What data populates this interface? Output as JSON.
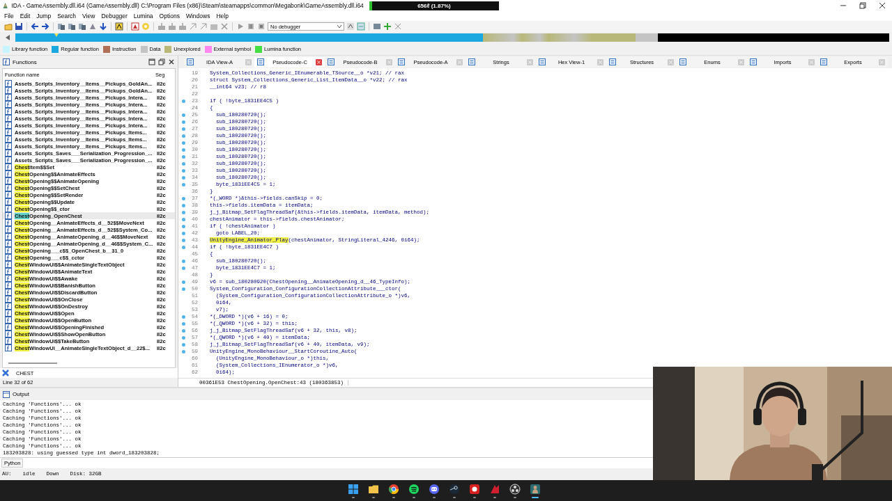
{
  "window": {
    "title": "IDA - GameAssembly.dll.i64 (GameAssembly.dll) C:\\Program Files (x86)\\Steam\\steamapps\\common\\Megabonk\\GameAssembly.dll.i64"
  },
  "meter": {
    "text": "656ℓ (1.87%)",
    "level": 0.02
  },
  "menu": [
    "File",
    "Edit",
    "Jump",
    "Search",
    "View",
    "Debugger",
    "Lumina",
    "Options",
    "Windows",
    "Help"
  ],
  "debugger_select": {
    "value": "No debugger"
  },
  "legend": [
    {
      "label": "Library function",
      "color": "#c8f4ff"
    },
    {
      "label": "Regular function",
      "color": "#1ba8e0"
    },
    {
      "label": "Instruction",
      "color": "#b07058"
    },
    {
      "label": "Data",
      "color": "#c4c4c4"
    },
    {
      "label": "Unexplored",
      "color": "#b8b878"
    },
    {
      "label": "External symbol",
      "color": "#ff88f0"
    },
    {
      "label": "Lumina function",
      "color": "#44dd44"
    }
  ],
  "functions_panel": {
    "title": "Functions",
    "columns": [
      "Function name",
      "Seg"
    ],
    "rows": [
      {
        "name": "Assets_Scripts_Inventory__Items__Pickups_GoldAn...",
        "seg": "il2c",
        "selected": false
      },
      {
        "name": "Assets_Scripts_Inventory__Items__Pickups_GoldAn...",
        "seg": "il2c",
        "selected": false
      },
      {
        "name": "Assets_Scripts_Inventory__Items__Pickups_Intera...",
        "seg": "il2c",
        "selected": false
      },
      {
        "name": "Assets_Scripts_Inventory__Items__Pickups_Intera...",
        "seg": "il2c",
        "selected": false
      },
      {
        "name": "Assets_Scripts_Inventory__Items__Pickups_Intera...",
        "seg": "il2c",
        "selected": false
      },
      {
        "name": "Assets_Scripts_Inventory__Items__Pickups_Intera...",
        "seg": "il2c",
        "selected": false
      },
      {
        "name": "Assets_Scripts_Inventory__Items__Pickups_Intera...",
        "seg": "il2c",
        "selected": false
      },
      {
        "name": "Assets_Scripts_Inventory__Items__Pickups_Items...",
        "seg": "il2c",
        "selected": false
      },
      {
        "name": "Assets_Scripts_Inventory__Items__Pickups_Items...",
        "seg": "il2c",
        "selected": false
      },
      {
        "name": "Assets_Scripts_Inventory__Items__Pickups_Items...",
        "seg": "il2c",
        "selected": false
      },
      {
        "name": "Assets_Scripts_Saves___Serialization_Progression_...",
        "seg": "il2c",
        "selected": false
      },
      {
        "name": "Assets_Scripts_Saves___Serialization_Progression_...",
        "seg": "il2c",
        "selected": false
      },
      {
        "match": "Chest",
        "name": "Item$$Set",
        "seg": "il2c",
        "selected": false
      },
      {
        "match": "Chest",
        "name": "Opening$$AnimateEffects",
        "seg": "il2c",
        "selected": false
      },
      {
        "match": "Chest",
        "name": "Opening$$AnimateOpening",
        "seg": "il2c",
        "selected": false
      },
      {
        "match": "Chest",
        "name": "Opening$$SetChest",
        "seg": "il2c",
        "selected": false
      },
      {
        "match": "Chest",
        "name": "Opening$$SetRender",
        "seg": "il2c",
        "selected": false
      },
      {
        "match": "Chest",
        "name": "Opening$$Update",
        "seg": "il2c",
        "selected": false
      },
      {
        "match": "Chest",
        "name": "Opening$$_ctor",
        "seg": "il2c",
        "selected": false
      },
      {
        "match": "Chest",
        "name": "Opening_OpenChest",
        "seg": "il2c",
        "selected": true
      },
      {
        "match": "Chest",
        "name": "Opening__AnimateEffects_d__52$$MoveNext",
        "seg": "il2c",
        "selected": false
      },
      {
        "match": "Chest",
        "name": "Opening__AnimateEffects_d__52$$System_Co...",
        "seg": "il2c",
        "selected": false
      },
      {
        "match": "Chest",
        "name": "Opening__AnimateOpening_d__46$$MoveNext",
        "seg": "il2c",
        "selected": false
      },
      {
        "match": "Chest",
        "name": "Opening__AnimateOpening_d__46$$System_C...",
        "seg": "il2c",
        "selected": false
      },
      {
        "match": "Chest",
        "name": "Opening___c$$_OpenChest_b__31_0",
        "seg": "il2c",
        "selected": false
      },
      {
        "match": "Chest",
        "name": "Opening___c$$_cctor",
        "seg": "il2c",
        "selected": false
      },
      {
        "match": "Chest",
        "name": "WindowUi$$AnimateSingleTextObject",
        "seg": "il2c",
        "selected": false
      },
      {
        "match": "Chest",
        "name": "WindowUi$$AnimateText",
        "seg": "il2c",
        "selected": false
      },
      {
        "match": "Chest",
        "name": "WindowUi$$Awake",
        "seg": "il2c",
        "selected": false
      },
      {
        "match": "Chest",
        "name": "WindowUi$$BanishButton",
        "seg": "il2c",
        "selected": false
      },
      {
        "match": "Chest",
        "name": "WindowUi$$DiscardButton",
        "seg": "il2c",
        "selected": false
      },
      {
        "match": "Chest",
        "name": "WindowUi$$OnClose",
        "seg": "il2c",
        "selected": false
      },
      {
        "match": "Chest",
        "name": "WindowUi$$OnDestroy",
        "seg": "il2c",
        "selected": false
      },
      {
        "match": "Chest",
        "name": "WindowUi$$Open",
        "seg": "il2c",
        "selected": false
      },
      {
        "match": "Chest",
        "name": "WindowUi$$OpenButton",
        "seg": "il2c",
        "selected": false
      },
      {
        "match": "Chest",
        "name": "WindowUi$$OpeningFinished",
        "seg": "il2c",
        "selected": false
      },
      {
        "match": "Chest",
        "name": "WindowUi$$ShowOpenButton",
        "seg": "il2c",
        "selected": false
      },
      {
        "match": "Chest",
        "name": "WindowUi$$TakeButton",
        "seg": "il2c",
        "selected": false
      },
      {
        "match": "Chest",
        "name": "WindowUi__AnimateSingleTextObject_d__22$...",
        "seg": "il2c",
        "selected": false
      }
    ],
    "filter": "CHEST",
    "position": "Line 32 of 62"
  },
  "tabs": [
    {
      "label": "IDA View-A",
      "selected": false
    },
    {
      "label": "Pseudocode-C",
      "selected": true
    },
    {
      "label": "Pseudocode-B",
      "selected": false
    },
    {
      "label": "Pseudocode-A",
      "selected": false
    },
    {
      "label": "Strings",
      "selected": false
    },
    {
      "label": "Hex View-1",
      "selected": false
    },
    {
      "label": "Structures",
      "selected": false
    },
    {
      "label": "Enums",
      "selected": false
    },
    {
      "label": "Imports",
      "selected": false
    },
    {
      "label": "Exports",
      "selected": false
    }
  ],
  "code": {
    "lines": [
      {
        "num": "19",
        "dot": false,
        "indented": false,
        "text": "System_Collections_Generic_IEnumerable_TSource__o *v21; // rax"
      },
      {
        "num": "20",
        "dot": false,
        "indented": false,
        "text": "struct System_Collections_Generic_List_ItemData__o *v22; // rax"
      },
      {
        "num": "21",
        "dot": false,
        "indented": false,
        "text": "__int64 v23; // r8"
      },
      {
        "num": "22",
        "dot": false
      },
      {
        "num": "23",
        "dot": true,
        "indented": false,
        "text": "if ( !byte_1831EE4C5 )"
      },
      {
        "num": "24",
        "dot": false,
        "indented": false,
        "text": "{"
      },
      {
        "num": "25",
        "dot": true,
        "indented": true,
        "text": "sub_180280720();"
      },
      {
        "num": "26",
        "dot": true,
        "indented": true,
        "text": "sub_180280720();"
      },
      {
        "num": "27",
        "dot": true,
        "indented": true,
        "text": "sub_180280720();"
      },
      {
        "num": "28",
        "dot": true,
        "indented": true,
        "text": "sub_180280720();"
      },
      {
        "num": "29",
        "dot": true,
        "indented": true,
        "text": "sub_180280720();"
      },
      {
        "num": "30",
        "dot": true,
        "indented": true,
        "text": "sub_180280720();"
      },
      {
        "num": "31",
        "dot": true,
        "indented": true,
        "text": "sub_180280720();"
      },
      {
        "num": "32",
        "dot": true,
        "indented": true,
        "text": "sub_180280720();"
      },
      {
        "num": "33",
        "dot": true,
        "indented": true,
        "text": "sub_180280720();"
      },
      {
        "num": "34",
        "dot": true,
        "indented": true,
        "text": "sub_180280720();"
      },
      {
        "num": "35",
        "dot": true,
        "indented": true,
        "text": "byte_1831EE4C5 = 1;"
      },
      {
        "num": "36",
        "dot": false,
        "indented": false,
        "text": "}"
      },
      {
        "num": "37",
        "dot": true,
        "indented": false,
        "text": "*(_WORD *)&this->fields.canSkip = 0;"
      },
      {
        "num": "38",
        "dot": true,
        "indented": false,
        "text": "this->fields.itemData = itemData;"
      },
      {
        "num": "39",
        "dot": true,
        "indented": false,
        "text": "j_j_Bitmap_SetFlagThreadSaf(&this->fields.itemData, itemData, method);"
      },
      {
        "num": "40",
        "dot": true,
        "indented": false,
        "text": "chestAnimator = this->fields.chestAnimator;"
      },
      {
        "num": "41",
        "dot": true,
        "indented": false,
        "text": "if ( !chestAnimator )"
      },
      {
        "num": "42",
        "dot": true,
        "indented": true,
        "text": "goto LABEL_20;"
      },
      {
        "num": "43",
        "dot": true,
        "indented": false,
        "highlighted": "UnityEngine_Animator_Play",
        "text": "(chestAnimator, StringLiteral_4246, 0i64);"
      },
      {
        "num": "44",
        "dot": true,
        "indented": false,
        "text": "if ( !byte_1831EE4C7 )"
      },
      {
        "num": "45",
        "dot": false,
        "indented": false,
        "text": "{"
      },
      {
        "num": "46",
        "dot": true,
        "indented": true,
        "text": "sub_180280720();"
      },
      {
        "num": "47",
        "dot": true,
        "indented": true,
        "text": "byte_1831EE4C7 = 1;"
      },
      {
        "num": "48",
        "dot": false,
        "indented": false,
        "text": "}"
      },
      {
        "num": "49",
        "dot": true,
        "indented": false,
        "text": "v6 = sub_180280920(ChestOpening__AnimateOpening_d__46_TypeInfo);"
      },
      {
        "num": "50",
        "dot": true,
        "indented": false,
        "text": "System_Configuration_ConfigurationCollectionAttribute___ctor("
      },
      {
        "num": "51",
        "dot": false,
        "indented": true,
        "text": "(System_Configuration_ConfigurationCollectionAttribute_o *)v6,"
      },
      {
        "num": "52",
        "dot": false,
        "indented": true,
        "text": "0i64,"
      },
      {
        "num": "53",
        "dot": false,
        "indented": true,
        "text": "v7);"
      },
      {
        "num": "54",
        "dot": true,
        "indented": false,
        "text": "*(_DWORD *)(v6 + 16) = 0;"
      },
      {
        "num": "55",
        "dot": true,
        "indented": false,
        "text": "*(_QWORD *)(v6 + 32) = this;"
      },
      {
        "num": "56",
        "dot": true,
        "indented": false,
        "text": "j_j_Bitmap_SetFlagThreadSaf(v6 + 32, this, v8);"
      },
      {
        "num": "57",
        "dot": true,
        "indented": false,
        "text": "*(_QWORD *)(v6 + 40) = itemData;"
      },
      {
        "num": "58",
        "dot": true,
        "indented": false,
        "text": "j_j_Bitmap_SetFlagThreadSaf(v6 + 40, itemData, v9);"
      },
      {
        "num": "59",
        "dot": true,
        "indented": false,
        "text": "UnityEngine_MonoBehaviour__StartCoroutine_Auto("
      },
      {
        "num": "60",
        "dot": false,
        "indented": true,
        "text": "(UnityEngine_MonoBehaviour_o *)this,"
      },
      {
        "num": "61",
        "dot": false,
        "indented": true,
        "text": "(System_Collections_IEnumerator_o *)v6,"
      },
      {
        "num": "62",
        "dot": false,
        "indented": true,
        "text": "0i64);"
      }
    ],
    "status": "00361E53 ChestOpening.OpenChest:43 (180363853)"
  },
  "output": {
    "title": "Output",
    "lines": [
      "Caching 'Functions'... ok",
      "Caching 'Functions'... ok",
      "Caching 'Functions'... ok",
      "Caching 'Functions'... ok",
      "Caching 'Functions'... ok",
      "Caching 'Functions'... ok",
      "Caching 'Functions'... ok",
      "183203828: using guessed type int dword_183203828;"
    ],
    "language_button": "Python"
  },
  "status_bar": [
    "AU:",
    "idle",
    "Down",
    "Disk: 32GB"
  ],
  "taskbar": [
    {
      "active": false
    },
    {
      "active": false
    },
    {
      "active": false
    },
    {
      "active": false
    },
    {
      "active": false
    },
    {
      "active": false
    },
    {
      "active": false
    },
    {
      "active": false
    },
    {
      "active": false
    },
    {
      "active": true
    }
  ]
}
